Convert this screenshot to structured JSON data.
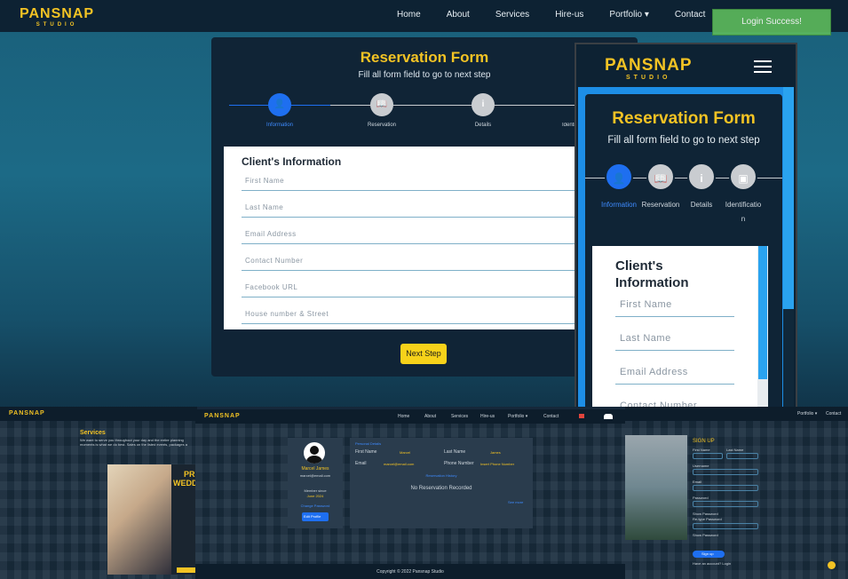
{
  "brand": {
    "name": "PANSNAP",
    "sub": "STUDIO"
  },
  "nav": {
    "links": [
      "Home",
      "About",
      "Services",
      "Hire-us",
      "Portfolio ▾",
      "Contact"
    ]
  },
  "toast": {
    "text": "Login Success!",
    "color": "#5cb85c"
  },
  "form": {
    "title": "Reservation Form",
    "subtitle": "Fill all form field to go to next step",
    "steps": [
      {
        "label": "Information",
        "icon": "user-icon",
        "glyph": "👤",
        "active": true
      },
      {
        "label": "Reservation",
        "icon": "book-icon",
        "glyph": "📖",
        "active": false
      },
      {
        "label": "Details",
        "icon": "info-icon",
        "glyph": "i",
        "active": false
      },
      {
        "label": "Identification",
        "icon": "id-card-icon",
        "glyph": "▣",
        "active": false
      }
    ],
    "section_heading": "Client's Information",
    "fields": [
      {
        "placeholder": "First Name"
      },
      {
        "placeholder": "Last Name"
      },
      {
        "placeholder": "Email Address"
      },
      {
        "placeholder": "Contact Number"
      },
      {
        "placeholder": "Facebook URL"
      },
      {
        "placeholder": "House number & Street"
      }
    ],
    "next_label": "Next Step"
  },
  "mobile": {
    "title": "Reservation Form",
    "subtitle": "Fill all form field to go to next step",
    "step_labels": [
      "Information",
      "Reservation",
      "Details",
      "Identificatio",
      "n"
    ],
    "heading_line1": "Client's",
    "heading_line2": "Information",
    "fields": [
      "First Name",
      "Last Name",
      "Email Address",
      "Contact Number"
    ]
  },
  "bottom": {
    "services": {
      "title": "Services",
      "text1": "We want to serve you throughout your day and the entire planning",
      "text2": "moments is what we do best. Sales on the listed events, packages a",
      "badge": "PR",
      "badge2": "WEDD"
    },
    "profile": {
      "nav_links": [
        "Home",
        "About",
        "Services",
        "Hire-us",
        "Portfolio ▾",
        "Contact"
      ],
      "name": "Marcel James",
      "email": "marcel@email.com",
      "member_since_label": "Member since",
      "member_since": "June 2024",
      "change_password": "Change Password",
      "edit_profile": "Edit Profile",
      "personal_details": "Personal Details",
      "first_name_label": "First Name",
      "first_name": "Marcel",
      "last_name_label": "Last Name",
      "last_name": "James",
      "email_label": "Email",
      "email_value": "marcel@email.com",
      "phone_label": "Phone Number",
      "phone_value": "Insert Phone Number",
      "history_title": "Reservation History",
      "empty_history": "No Reservation Recorded",
      "see_more": "See more",
      "copyright": "Copyright © 2022 Pansnap Studio"
    },
    "signup": {
      "nav_links": [
        "Portfolio ▾",
        "Contact"
      ],
      "title": "SIGN UP",
      "first_name": "First Name",
      "last_name": "Last Name",
      "username": "Username",
      "email": "Email",
      "password": "Password",
      "show_password": "Show Password",
      "retype": "Re-type Password",
      "show_password2": "Show Password",
      "button": "Sign up",
      "login_prompt": "Have an account? Login"
    }
  }
}
